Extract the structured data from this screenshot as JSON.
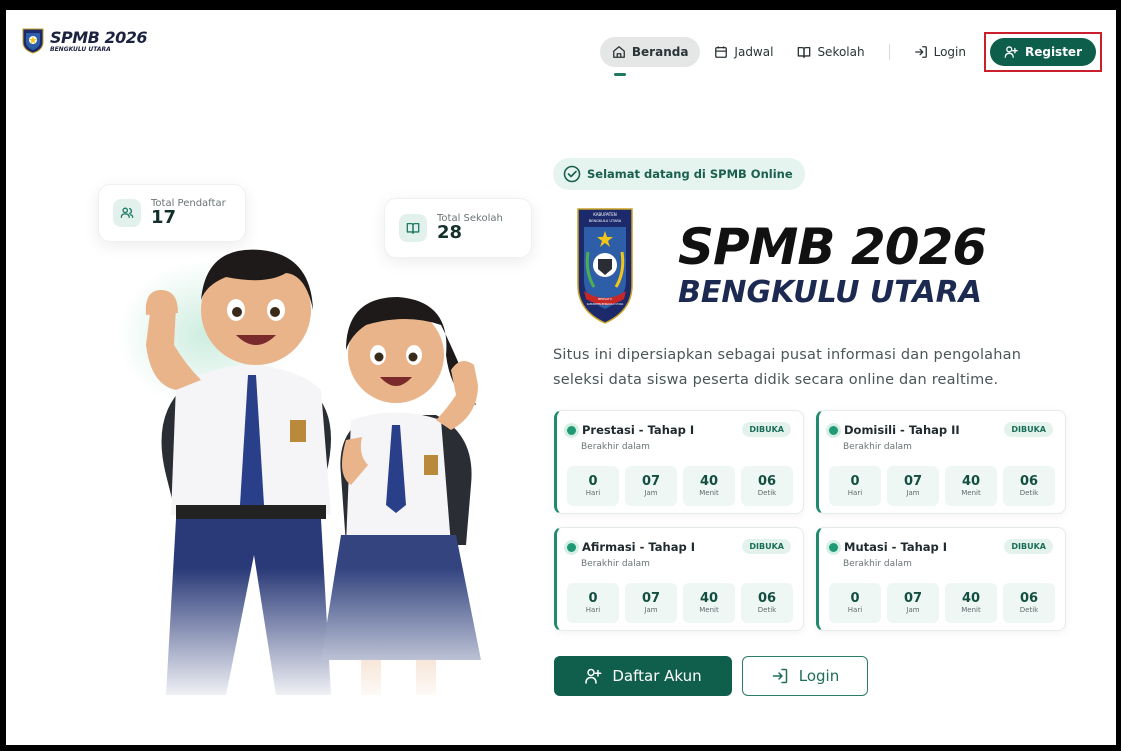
{
  "brand": {
    "title": "SPMB 2026",
    "subtitle": "BENGKULU UTARA",
    "icon": "bengkulu-utara-crest-icon"
  },
  "nav": {
    "items": [
      {
        "label": "Beranda",
        "icon": "home-icon",
        "active": true
      },
      {
        "label": "Jadwal",
        "icon": "calendar-icon",
        "active": false
      },
      {
        "label": "Sekolah",
        "icon": "book-open-icon",
        "active": false
      },
      {
        "label": "Login",
        "icon": "login-icon",
        "active": false
      }
    ],
    "register": {
      "label": "Register",
      "icon": "user-plus-icon"
    }
  },
  "stats": {
    "pendaftar": {
      "label": "Total Pendaftar",
      "value": "17",
      "icon": "users-icon"
    },
    "sekolah": {
      "label": "Total Sekolah",
      "value": "28",
      "icon": "book-open-icon"
    }
  },
  "hero": {
    "welcome": "Selamat datang di SPMB Online",
    "emblem_text": {
      "top": "KABUPATEN",
      "mid": "BENGKULU UTARA",
      "bottom": "BERSATU",
      "ribbon": "KABUPATEN BENGKULU UTARA"
    },
    "title": "SPMB 2026",
    "subtitle": "BENGKULU UTARA",
    "description": "Situs ini dipersiapkan sebagai pusat informasi dan pengolahan seleksi data siswa peserta didik secara online dan realtime."
  },
  "stages": [
    {
      "name": "Prestasi - Tahap I",
      "badge": "DIBUKA",
      "ends": "Berakhir dalam",
      "countdown": [
        "0",
        "07",
        "40",
        "06"
      ]
    },
    {
      "name": "Domisili - Tahap II",
      "badge": "DIBUKA",
      "ends": "Berakhir dalam",
      "countdown": [
        "0",
        "07",
        "40",
        "06"
      ]
    },
    {
      "name": "Afirmasi - Tahap I",
      "badge": "DIBUKA",
      "ends": "Berakhir dalam",
      "countdown": [
        "0",
        "07",
        "40",
        "06"
      ]
    },
    {
      "name": "Mutasi - Tahap I",
      "badge": "DIBUKA",
      "ends": "Berakhir dalam",
      "countdown": [
        "0",
        "07",
        "40",
        "06"
      ]
    }
  ],
  "countdown_units": [
    "Hari",
    "Jam",
    "Menit",
    "Detik"
  ],
  "cta": {
    "primary": {
      "label": "Daftar Akun",
      "icon": "user-plus-icon"
    },
    "secondary": {
      "label": "Login",
      "icon": "login-icon"
    }
  },
  "colors": {
    "primary": "#0e5e4c",
    "accent": "#1f9a74",
    "highlight_border": "#cc1f2d"
  }
}
